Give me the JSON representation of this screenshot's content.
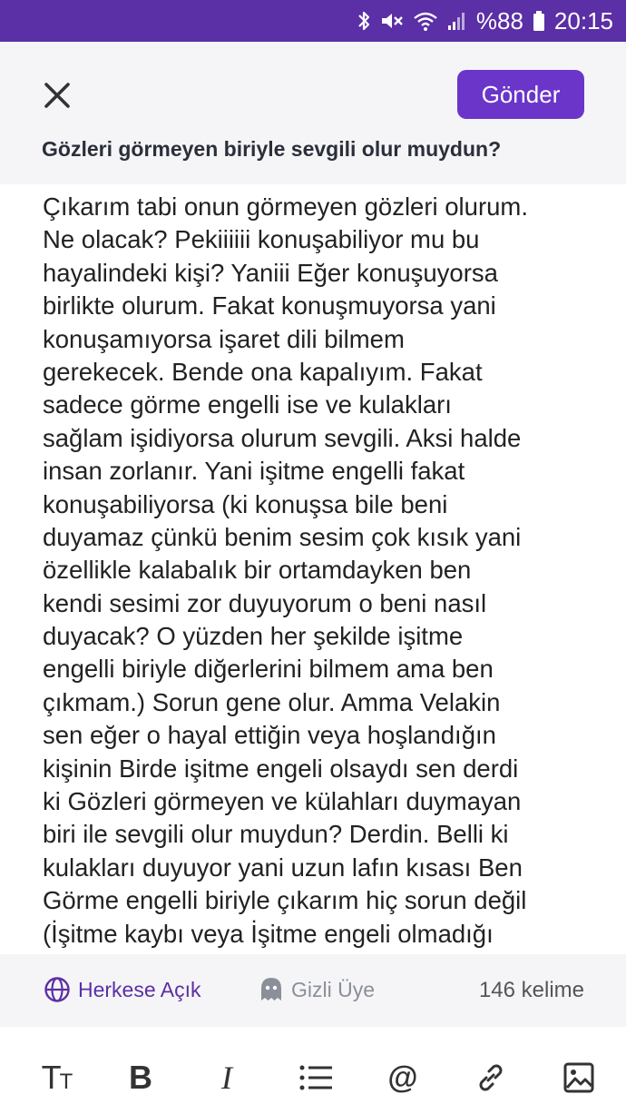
{
  "status_bar": {
    "battery": "%88",
    "time": "20:15"
  },
  "header": {
    "send_label": "Gönder",
    "question": "Gözleri görmeyen biriyle sevgili olur muydun?"
  },
  "editor": {
    "lines": [
      "Çıkarım tabi onun görmeyen gözleri olurum.",
      "Ne olacak? Pekiiiiii konuşabiliyor mu bu",
      "hayalindeki kişi? Yaniii Eğer konuşuyorsa",
      "birlikte olurum. Fakat konuşmuyorsa yani",
      "konuşamıyorsa işaret dili bilmem",
      "gerekecek. Bende ona kapalıyım. Fakat",
      "sadece görme engelli ise ve kulakları",
      "sağlam işidiyorsa olurum sevgili. Aksi halde",
      "insan zorlanır. Yani işitme engelli fakat",
      "konuşabiliyorsa (ki konuşsa bile beni",
      "duyamaz çünkü benim sesim çok kısık yani",
      "özellikle kalabalık bir ortamdayken ben",
      "kendi sesimi zor duyuyorum o beni nasıl",
      "duyacak? O yüzden her şekilde işitme",
      "engelli biriyle diğerlerini bilmem ama ben",
      "çıkmam.) Sorun gene olur. Amma Velakin",
      "sen eğer o hayal ettiğin veya hoşlandığın",
      "kişinin Birde işitme engeli olsaydı sen derdi",
      "ki Gözleri görmeyen ve külahları duymayan",
      "biri ile sevgili olur muydun? Derdin. Belli ki",
      "kulakları duyuyor yani uzun lafın kısası Ben",
      "Görme engelli biriyle çıkarım hiç sorun değil",
      "(İşitme kaybı veya İşitme engeli olmadığı"
    ]
  },
  "footer": {
    "visibility_label": "Herkese Açık",
    "anonymous_label": "Gizli Üye",
    "word_count": "146 kelime"
  },
  "toolbar": {
    "text_size_label": "TT",
    "bold_label": "B",
    "italic_label": "I",
    "mention_label": "@"
  },
  "colors": {
    "brand": "#6b35c9",
    "status_bar": "#5b2fa5"
  },
  "icons": [
    "bluetooth-icon",
    "mute-icon",
    "wifi-icon",
    "signal-icon",
    "battery-icon",
    "close-icon",
    "globe-icon",
    "ghost-icon",
    "list-icon",
    "link-icon",
    "image-icon"
  ]
}
